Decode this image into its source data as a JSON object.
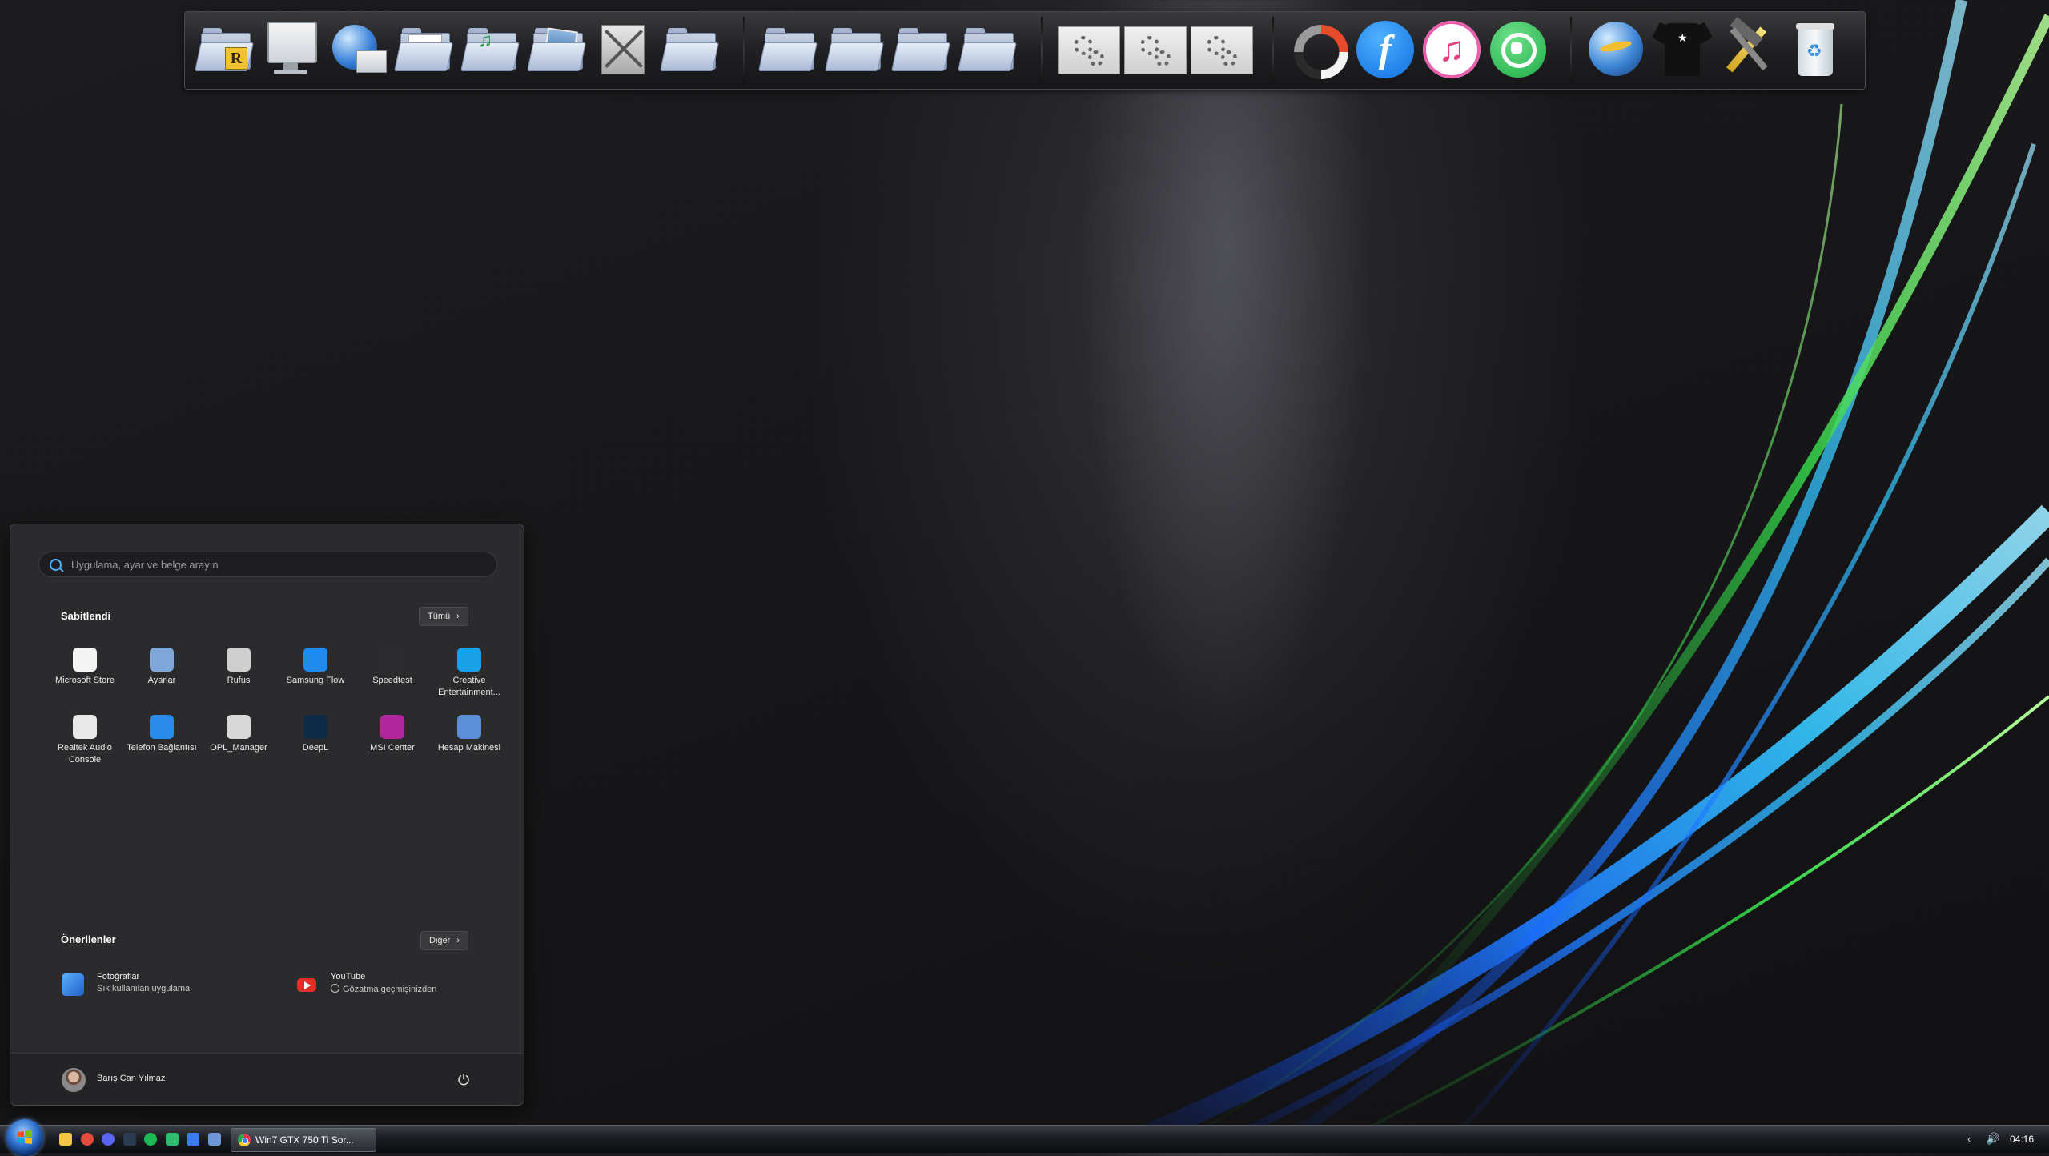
{
  "dock": {
    "items": [
      {
        "icon": "recent-folder-icon",
        "letter": "R"
      },
      {
        "icon": "computer-icon"
      },
      {
        "icon": "network-globe-icon"
      },
      {
        "icon": "documents-folder-icon"
      },
      {
        "icon": "music-folder-icon"
      },
      {
        "icon": "pictures-folder-icon"
      },
      {
        "icon": "tools-folder-icon"
      },
      {
        "icon": "folder-icon"
      },
      {
        "icon": "folder-icon"
      },
      {
        "icon": "folder-icon"
      },
      {
        "icon": "folder-icon"
      },
      {
        "icon": "folder-icon"
      },
      {
        "icon": "settings-gear-icon"
      },
      {
        "icon": "settings-gear-icon"
      },
      {
        "icon": "settings-gear-icon"
      },
      {
        "icon": "ring-app-icon"
      },
      {
        "icon": "samsung-flow-icon",
        "letter": "f"
      },
      {
        "icon": "itunes-music-icon",
        "letter": "♫"
      },
      {
        "icon": "whatsapp-icon"
      },
      {
        "icon": "internet-globe-icon"
      },
      {
        "icon": "tshirt-icon"
      },
      {
        "icon": "hammer-tools-icon"
      },
      {
        "icon": "recycle-bin-icon"
      }
    ]
  },
  "start_menu": {
    "search_placeholder": "Uygulama, ayar ve belge arayın",
    "pinned_title": "Sabitlendi",
    "all_button": "Tümü",
    "pinned_apps": [
      {
        "label": "Microsoft Store",
        "icon": "microsoft-store-icon",
        "color": "#f4f4f4"
      },
      {
        "label": "Ayarlar",
        "icon": "settings-icon",
        "color": "#7fa7d8"
      },
      {
        "label": "Rufus",
        "icon": "usb-drive-icon",
        "color": "#cfcfcf"
      },
      {
        "label": "Samsung Flow",
        "icon": "samsung-flow-icon",
        "color": "#1f8bf0"
      },
      {
        "label": "Speedtest",
        "icon": "speedometer-icon",
        "color": "#2c2c30"
      },
      {
        "label": "Creative Entertainment...",
        "icon": "creative-app-icon",
        "color": "#18a0e8"
      },
      {
        "label": "Realtek Audio Console",
        "icon": "audio-knob-icon",
        "color": "#e8e8e8"
      },
      {
        "label": "Telefon Bağlantısı",
        "icon": "phone-link-icon",
        "color": "#2b8be8"
      },
      {
        "label": "OPL_Manager",
        "icon": "ps2-console-icon",
        "color": "#d8d8d8"
      },
      {
        "label": "DeepL",
        "icon": "deepl-icon",
        "color": "#0f2b46"
      },
      {
        "label": "MSI Center",
        "icon": "msi-center-icon",
        "color": "#b1269c"
      },
      {
        "label": "Hesap Makinesi",
        "icon": "calculator-icon",
        "color": "#5d8fd8"
      }
    ],
    "recommended_title": "Önerilenler",
    "more_button": "Diğer",
    "recommended": [
      {
        "title": "Fotoğraflar",
        "subtitle": "Sık kullanılan uygulama",
        "icon": "photos-icon",
        "color": "#3a8ee6"
      },
      {
        "title": "YouTube",
        "subtitle": "Gözatma geçmişinizden",
        "icon": "youtube-icon",
        "color": "#e52d27"
      }
    ],
    "user_name": "Barış Can Yılmaz"
  },
  "taskbar": {
    "pinned_icons": [
      {
        "icon": "file-explorer-icon",
        "color": "#f2c544"
      },
      {
        "icon": "chrome-icon",
        "color": "#e34c3c"
      },
      {
        "icon": "discord-icon",
        "color": "#5865f2"
      },
      {
        "icon": "steam-icon",
        "color": "#2a3b52"
      },
      {
        "icon": "spotify-icon",
        "color": "#1db954"
      },
      {
        "icon": "green-app-icon",
        "color": "#2dbb6e"
      },
      {
        "icon": "blue-app-icon",
        "color": "#3b7bf2"
      },
      {
        "icon": "calculator-icon",
        "color": "#6f96d6"
      }
    ],
    "active_task": "Win7 GTX 750 Ti Sor...",
    "clock": "04:16"
  }
}
